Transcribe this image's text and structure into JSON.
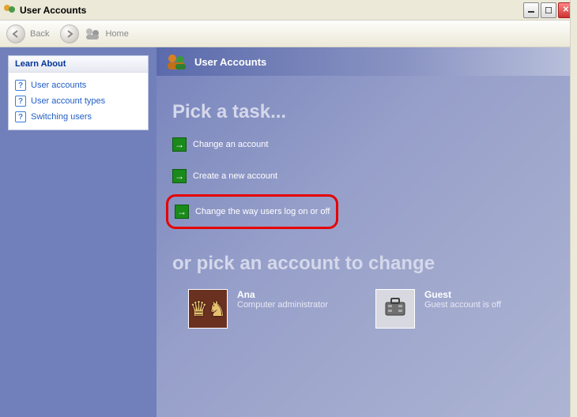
{
  "window": {
    "title": "User Accounts"
  },
  "toolbar": {
    "back_label": "Back",
    "home_label": "Home"
  },
  "sidebar": {
    "header": "Learn About",
    "items": [
      {
        "label": "User accounts"
      },
      {
        "label": "User account types"
      },
      {
        "label": "Switching users"
      }
    ]
  },
  "banner": {
    "title": "User Accounts"
  },
  "headings": {
    "pick_task": "Pick a task...",
    "pick_account": "or pick an account to change"
  },
  "tasks": {
    "change_account": "Change an account",
    "create_account": "Create a new account",
    "change_logon": "Change the way users log on or off"
  },
  "accounts": [
    {
      "name": "Ana",
      "role": "Computer administrator",
      "type": "user"
    },
    {
      "name": "Guest",
      "role": "Guest account is off",
      "type": "guest"
    }
  ]
}
